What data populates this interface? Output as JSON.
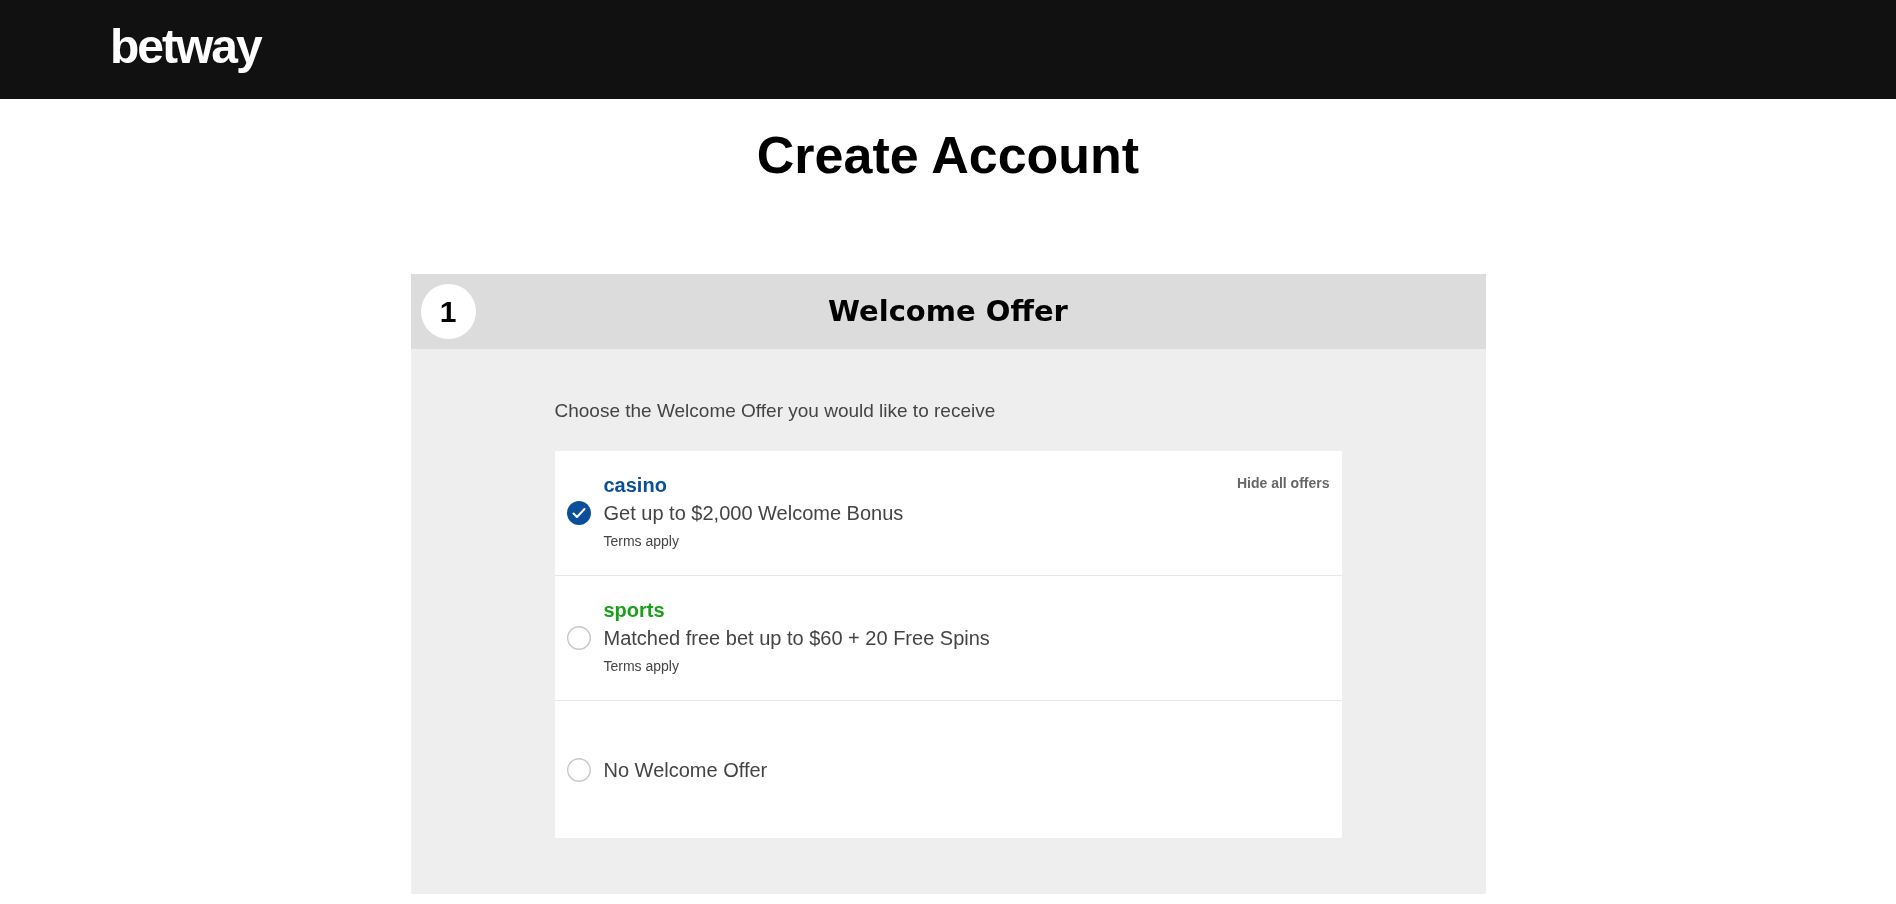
{
  "header": {
    "logo": "betway"
  },
  "title": "Create Account",
  "step": {
    "number": "1",
    "title": "Welcome Offer"
  },
  "intro": "Choose the Welcome Offer you would like to receive",
  "hide_link": "Hide all offers",
  "offers": [
    {
      "kind": "offer",
      "category": "casino",
      "color": "#0b4f9c",
      "description": "Get up to $2,000 Welcome Bonus",
      "terms": "Terms apply",
      "selected": true
    },
    {
      "kind": "offer",
      "category": "sports",
      "color": "#1aa11a",
      "description": "Matched free bet up to $60 + 20 Free Spins",
      "terms": "Terms apply",
      "selected": false
    },
    {
      "kind": "none",
      "description": "No Welcome Offer",
      "selected": false
    }
  ]
}
